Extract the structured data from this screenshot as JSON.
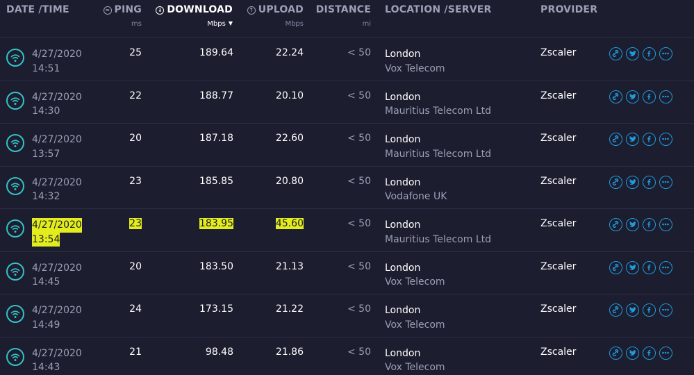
{
  "headers": {
    "datetime": "DATE /TIME",
    "ping": "PING",
    "ping_unit": "ms",
    "download": "DOWNLOAD",
    "download_unit": "Mbps",
    "upload": "UPLOAD",
    "upload_unit": "Mbps",
    "distance": "DISTANCE",
    "distance_unit": "mi",
    "location": "LOCATION /SERVER",
    "provider": "PROVIDER"
  },
  "sort": {
    "column": "download",
    "direction": "descending",
    "indicator": "▼"
  },
  "colors": {
    "background": "#1c1d2f",
    "accent_wifi": "#35c2c7",
    "accent_actions": "#1f9cdf",
    "highlight": "#e3ec1c"
  },
  "rows": [
    {
      "date": "4/27/2020",
      "time": "14:51",
      "ping": "25",
      "download": "189.64",
      "upload": "22.24",
      "distance": "< 50",
      "city": "London",
      "server": "Vox Telecom",
      "provider": "Zscaler",
      "highlighted": false
    },
    {
      "date": "4/27/2020",
      "time": "14:30",
      "ping": "22",
      "download": "188.77",
      "upload": "20.10",
      "distance": "< 50",
      "city": "London",
      "server": "Mauritius Telecom Ltd",
      "provider": "Zscaler",
      "highlighted": false
    },
    {
      "date": "4/27/2020",
      "time": "13:57",
      "ping": "20",
      "download": "187.18",
      "upload": "22.60",
      "distance": "< 50",
      "city": "London",
      "server": "Mauritius Telecom Ltd",
      "provider": "Zscaler",
      "highlighted": false
    },
    {
      "date": "4/27/2020",
      "time": "14:32",
      "ping": "23",
      "download": "185.85",
      "upload": "20.80",
      "distance": "< 50",
      "city": "London",
      "server": "Vodafone UK",
      "provider": "Zscaler",
      "highlighted": false
    },
    {
      "date": "4/27/2020",
      "time": "13:54",
      "ping": "23",
      "download": "183.95",
      "upload": "45.60",
      "distance": "< 50",
      "city": "London",
      "server": "Mauritius Telecom Ltd",
      "provider": "Zscaler",
      "highlighted": true
    },
    {
      "date": "4/27/2020",
      "time": "14:45",
      "ping": "20",
      "download": "183.50",
      "upload": "21.13",
      "distance": "< 50",
      "city": "London",
      "server": "Vox Telecom",
      "provider": "Zscaler",
      "highlighted": false
    },
    {
      "date": "4/27/2020",
      "time": "14:49",
      "ping": "24",
      "download": "173.15",
      "upload": "21.22",
      "distance": "< 50",
      "city": "London",
      "server": "Vox Telecom",
      "provider": "Zscaler",
      "highlighted": false
    },
    {
      "date": "4/27/2020",
      "time": "14:43",
      "ping": "21",
      "download": "98.48",
      "upload": "21.86",
      "distance": "< 50",
      "city": "London",
      "server": "Vox Telecom",
      "provider": "Zscaler",
      "highlighted": false
    }
  ],
  "row_actions": [
    "link-icon",
    "twitter-icon",
    "facebook-icon",
    "more-icon"
  ]
}
